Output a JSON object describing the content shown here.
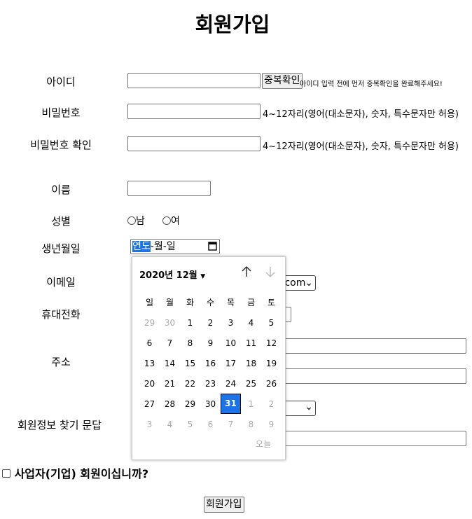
{
  "page": {
    "title": "회원가입",
    "labels": {
      "id": "아이디",
      "password": "비밀번호",
      "password_confirm": "비밀번호 확인",
      "name": "이름",
      "gender": "성별",
      "birth": "생년월일",
      "email": "이메일",
      "phone": "휴대전화",
      "address": "주소",
      "recovery": "회원정보 찾기 문답"
    },
    "id_check_button": "중복확인",
    "id_hint": "아이디 입력 전에 먼저 중복확인을 완료해주세요!",
    "password_hint": "4~12자리(영어(대소문자), 숫자, 특수문자만 허용)",
    "password_confirm_hint": "4~12자리(영어(대소문자), 숫자, 특수문자만 허용)",
    "gender_options": [
      "남",
      "여"
    ],
    "date_placeholder": {
      "year": "연도",
      "sep1": "-",
      "month": "월",
      "sep2": "-",
      "day": "일"
    },
    "email_domain": ".com",
    "business_check_label": "사업자(기업) 회원이십니까?",
    "submit_button": "회원가입"
  },
  "calendar": {
    "month_label": "2020년 12월",
    "weekdays": [
      "일",
      "월",
      "화",
      "수",
      "목",
      "금",
      "토"
    ],
    "weeks": [
      [
        "29",
        "30",
        "1",
        "2",
        "3",
        "4",
        "5"
      ],
      [
        "6",
        "7",
        "8",
        "9",
        "10",
        "11",
        "12"
      ],
      [
        "13",
        "14",
        "15",
        "16",
        "17",
        "18",
        "19"
      ],
      [
        "20",
        "21",
        "22",
        "23",
        "24",
        "25",
        "26"
      ],
      [
        "27",
        "28",
        "29",
        "30",
        "31",
        "1",
        "2"
      ],
      [
        "3",
        "4",
        "5",
        "6",
        "7",
        "8",
        "9"
      ]
    ],
    "selected_day": "31",
    "today_label": "오늘"
  }
}
